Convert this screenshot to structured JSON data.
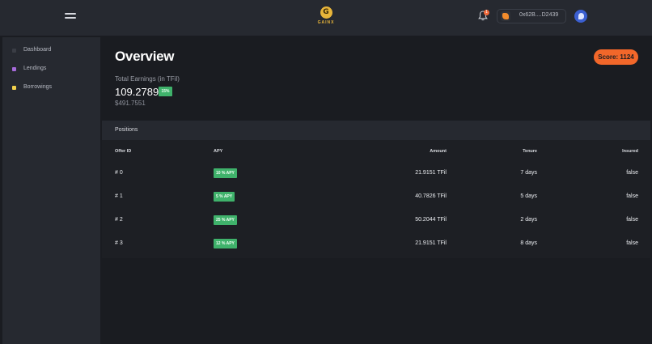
{
  "header": {
    "logo_text": "GAINX",
    "logo_letter": "G",
    "notification_count": "1",
    "wallet_address": "0x62B....D2439"
  },
  "sidebar": {
    "items": [
      {
        "label": "Dashboard",
        "color": "#2f3238"
      },
      {
        "label": "Lendings",
        "color": "#a56ad9"
      },
      {
        "label": "Borrowings",
        "color": "#f2d04c"
      }
    ]
  },
  "overview": {
    "title": "Overview",
    "score_label": "Score: 1124",
    "earnings_label": "Total Earnings (in TFil)",
    "earnings_value": "109.2789",
    "earnings_badge": "15%",
    "earnings_usd": "$491.7551"
  },
  "positions": {
    "section_title": "Positions",
    "columns": [
      "Offer ID",
      "APY",
      "Amount",
      "Tenure",
      "Insured"
    ],
    "rows": [
      {
        "id": "# 0",
        "apy": "10 % APY",
        "amount": "21.9151 TFil",
        "tenure": "7 days",
        "insured": "false"
      },
      {
        "id": "# 1",
        "apy": "5 % APY",
        "amount": "40.7826 TFil",
        "tenure": "5 days",
        "insured": "false"
      },
      {
        "id": "# 2",
        "apy": "25 % APY",
        "amount": "50.2044 TFil",
        "tenure": "2 days",
        "insured": "false"
      },
      {
        "id": "# 3",
        "apy": "12 % APY",
        "amount": "21.9151 TFil",
        "tenure": "8 days",
        "insured": "false"
      }
    ]
  },
  "colors": {
    "accent": "#f2672a",
    "positive": "#3fb26b",
    "panel": "#262930",
    "background": "#1a1c21"
  }
}
